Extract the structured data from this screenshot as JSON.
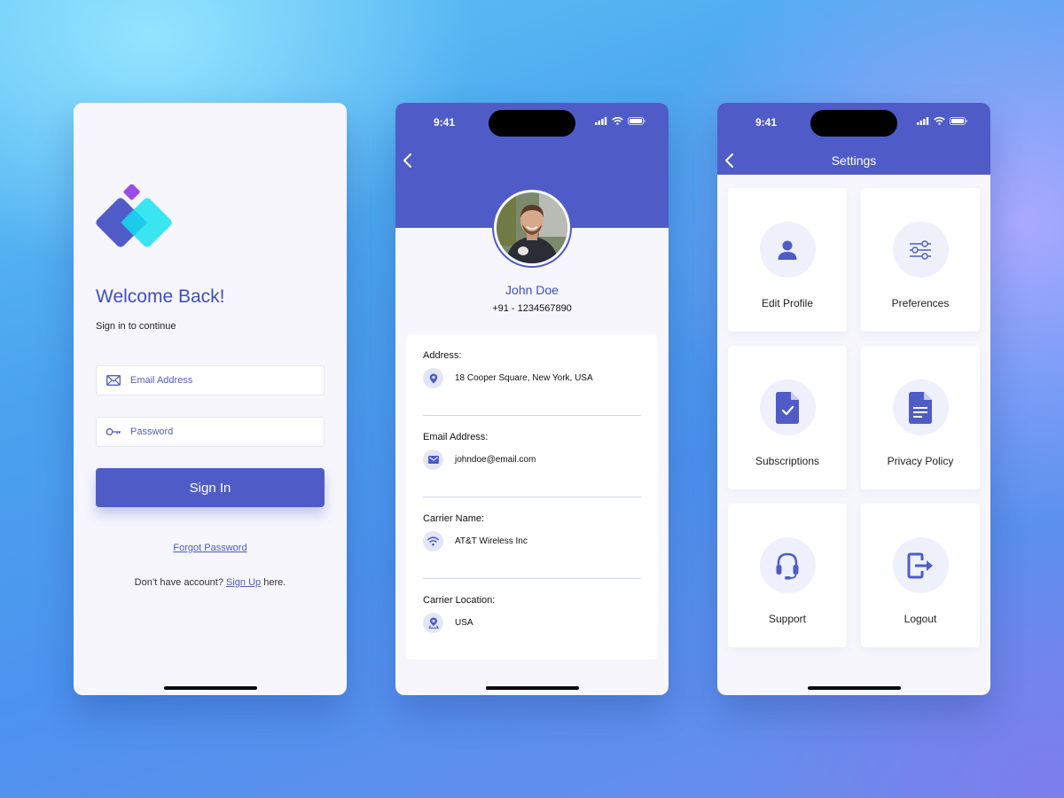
{
  "colors": {
    "primary": "#4f5cc8",
    "heading": "#3f4ec0",
    "bubble": "#e3e6f6"
  },
  "login": {
    "title": "Welcome Back!",
    "subtitle": "Sign in to continue",
    "email_placeholder": "Email Address",
    "password_placeholder": "Password",
    "sign_in": "Sign In",
    "forgot": "Forgot Password",
    "signup_prefix": "Don’t have account? ",
    "signup_link": "Sign Up",
    "signup_suffix": " here."
  },
  "status": {
    "time": "9:41"
  },
  "profile": {
    "name": "John Doe",
    "phone": "+91 - 1234567890",
    "items": [
      {
        "label": "Address:",
        "value": "18 Cooper Square, New York, USA",
        "icon": "location-pin-icon"
      },
      {
        "label": "Email Address:",
        "value": "johndoe@email.com",
        "icon": "mail-icon"
      },
      {
        "label": "Carrier Name:",
        "value": "AT&T Wireless Inc",
        "icon": "wifi-icon"
      },
      {
        "label": "Carrier Location:",
        "value": "USA",
        "icon": "map-marker-icon"
      }
    ]
  },
  "settings": {
    "title": "Settings",
    "tiles": [
      {
        "label": "Edit Profile",
        "icon": "user-icon"
      },
      {
        "label": "Preferences",
        "icon": "sliders-icon"
      },
      {
        "label": "Subscriptions",
        "icon": "document-check-icon"
      },
      {
        "label": "Privacy Policy",
        "icon": "document-icon"
      },
      {
        "label": "Support",
        "icon": "headset-icon"
      },
      {
        "label": "Logout",
        "icon": "logout-icon"
      }
    ]
  }
}
